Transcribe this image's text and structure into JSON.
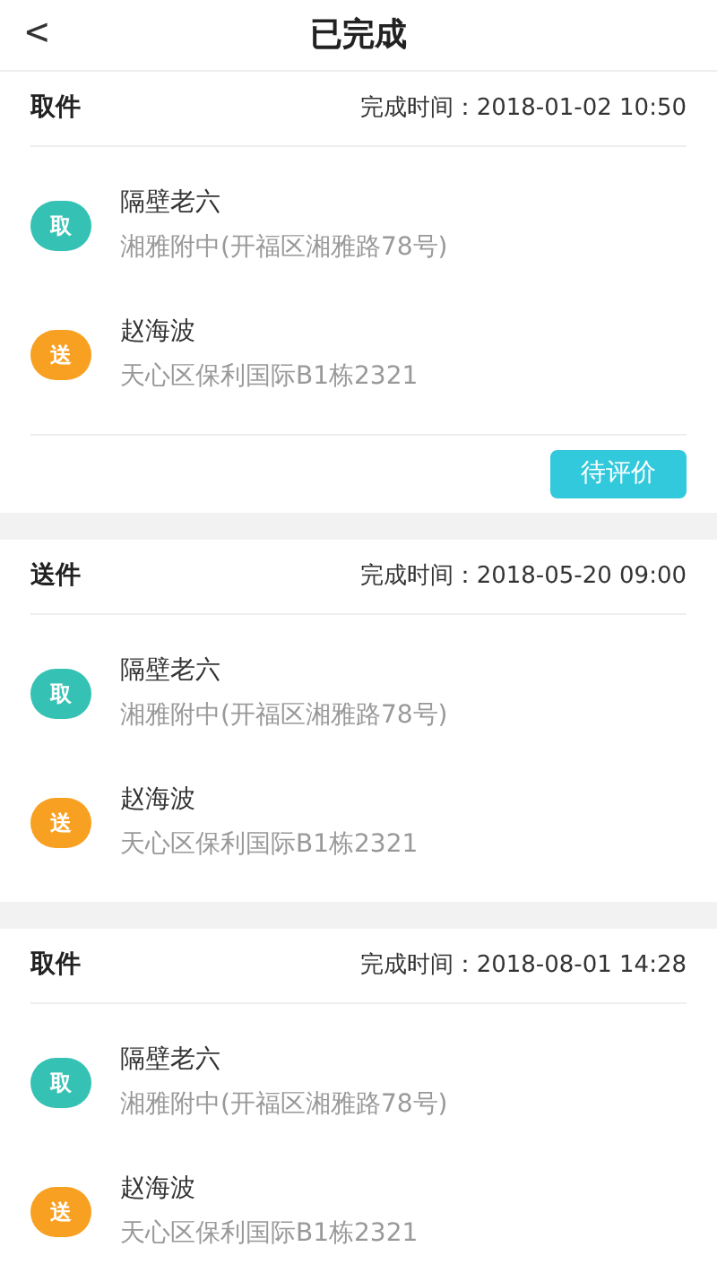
{
  "header": {
    "back": "<",
    "title": "已完成"
  },
  "orders": [
    {
      "type": "取件",
      "time_label": "完成时间：",
      "time": "2018-01-02 10:50",
      "stops": [
        {
          "kind": "pickup",
          "badge": "取",
          "name": "隔壁老六",
          "address": "湘雅附中(开福区湘雅路78号)"
        },
        {
          "kind": "delivery",
          "badge": "送",
          "name": "赵海波",
          "address": "天心区保利国际B1栋2321"
        }
      ],
      "action": "待评价"
    },
    {
      "type": "送件",
      "time_label": "完成时间：",
      "time": "2018-05-20 09:00",
      "stops": [
        {
          "kind": "pickup",
          "badge": "取",
          "name": "隔壁老六",
          "address": "湘雅附中(开福区湘雅路78号)"
        },
        {
          "kind": "delivery",
          "badge": "送",
          "name": "赵海波",
          "address": "天心区保利国际B1栋2321"
        }
      ]
    },
    {
      "type": "取件",
      "time_label": "完成时间：",
      "time": "2018-08-01 14:28",
      "stops": [
        {
          "kind": "pickup",
          "badge": "取",
          "name": "隔壁老六",
          "address": "湘雅附中(开福区湘雅路78号)"
        },
        {
          "kind": "delivery",
          "badge": "送",
          "name": "赵海波",
          "address": "天心区保利国际B1栋2321"
        }
      ]
    }
  ]
}
